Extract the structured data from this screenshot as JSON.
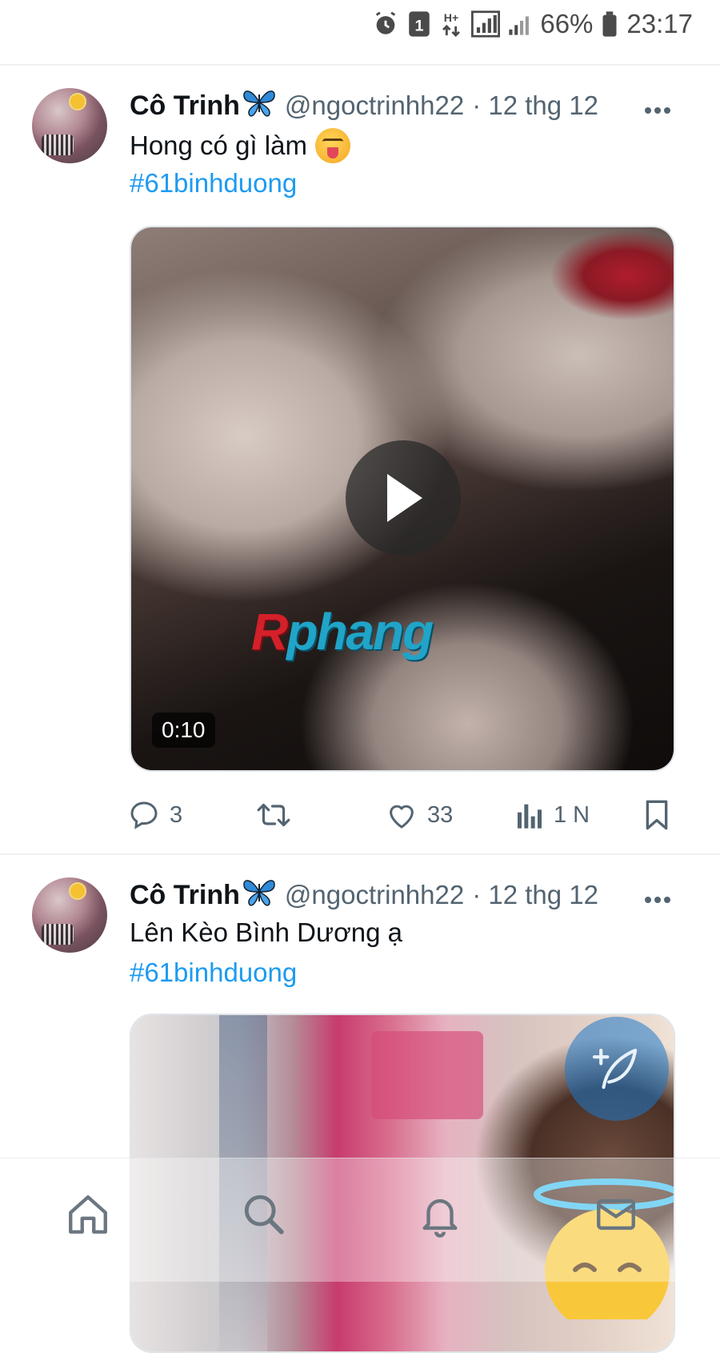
{
  "status_bar": {
    "battery_percent": "66%",
    "time": "23:17",
    "sim_badge": "1",
    "network_type": "H+"
  },
  "tweets": [
    {
      "name": "Cô Trinh",
      "handle": "@ngoctrinhh22",
      "date": "· 12 thg 12",
      "text": "Hong có gì làm",
      "hashtag": "#61binhduong",
      "media_type": "video",
      "duration": "0:10",
      "watermark_r": "R",
      "watermark_rest": "phang",
      "replies": "3",
      "retweets": "",
      "likes": "33",
      "views": "1 N"
    },
    {
      "name": "Cô Trinh",
      "handle": "@ngoctrinhh22",
      "date": "· 12 thg 12",
      "text": "Lên Kèo Bình Dương ạ",
      "hashtag": "#61binhduong",
      "media_type": "image"
    }
  ],
  "icons": {
    "more": "more-icon",
    "reply": "reply-icon",
    "retweet": "retweet-icon",
    "like": "heart-icon",
    "views": "views-icon",
    "bookmark": "bookmark-icon",
    "compose": "compose-icon",
    "nav": [
      "home-icon",
      "search-icon",
      "bell-icon",
      "mail-icon"
    ]
  },
  "colors": {
    "link": "#1d9bf0",
    "secondary_text": "#536471",
    "fab": "#1d78c8"
  }
}
